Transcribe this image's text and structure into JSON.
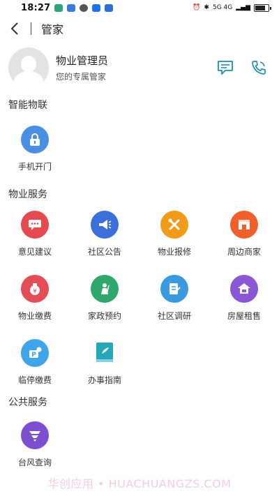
{
  "status_bar": {
    "time": "18:27",
    "right_text": "5G 4G"
  },
  "header": {
    "title": "管家"
  },
  "profile": {
    "name": "物业管理员",
    "subtitle": "您的专属管家"
  },
  "sections": {
    "smart": {
      "title": "智能物联",
      "items": [
        {
          "label": "手机开门",
          "icon": "lock-icon",
          "color": "#4a90e2"
        }
      ]
    },
    "property": {
      "title": "物业服务",
      "items": [
        {
          "label": "意见建议",
          "icon": "chat-bubble-icon",
          "color": "#e64950"
        },
        {
          "label": "社区公告",
          "icon": "megaphone-icon",
          "color": "#3b6fd9"
        },
        {
          "label": "物业报修",
          "icon": "tools-icon",
          "color": "#f29b1b"
        },
        {
          "label": "周边商家",
          "icon": "shop-icon",
          "color": "#f0602d"
        },
        {
          "label": "物业缴费",
          "icon": "money-bag-icon",
          "color": "#e44d55"
        },
        {
          "label": "家政预约",
          "icon": "housekeeper-icon",
          "color": "#2fa66a"
        },
        {
          "label": "社区调研",
          "icon": "survey-icon",
          "color": "#3a9ae0"
        },
        {
          "label": "房屋租售",
          "icon": "house-icon",
          "color": "#8a57d6"
        },
        {
          "label": "临停缴费",
          "icon": "parking-fee-icon",
          "color": "#3da5e8"
        },
        {
          "label": "办事指南",
          "icon": "guide-book-icon",
          "color": "#25a7b8"
        }
      ]
    },
    "public": {
      "title": "公共服务",
      "items": [
        {
          "label": "台风查询",
          "icon": "typhoon-icon",
          "color": "#7b4fd0"
        }
      ]
    }
  },
  "watermark": "华创应用 • HUACHUANGZS.COM"
}
